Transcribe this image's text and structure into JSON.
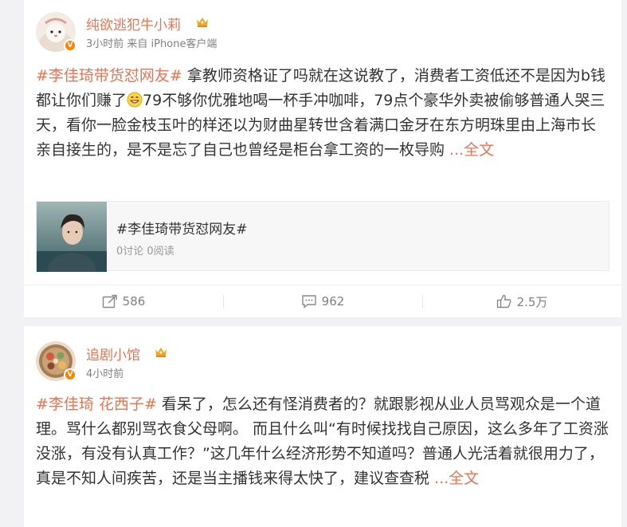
{
  "posts": [
    {
      "username": "纯欲逃犯牛小莉",
      "time": "3小时前",
      "source": "来自 iPhone客户端",
      "text_tag": "#李佳琦带货怼网友#",
      "text_body_1": " 拿教师资格证了吗就在这说教了，消费者工资低还不是因为b钱都让你们赚了",
      "text_body_2": "79不够你优雅地喝一杯手冲咖啡，79点个豪华外卖被偷够普通人哭三天，看你一脸金枝玉叶的样还以为财曲星转世含着满口金牙在东方明珠里由上海市长亲自接生的，是不是忘了自己也曾经是柜台拿工资的一枚导购 ",
      "more": "...全文",
      "topic": {
        "title": "#李佳琦带货怼网友#",
        "stats": "0讨论 0阅读"
      },
      "actions": {
        "repost": "586",
        "comment": "962",
        "like": "2.5万"
      }
    },
    {
      "username": "追剧小馆",
      "time": "4小时前",
      "text_tag": "#李佳琦 花西子#",
      "text_body_1": " 看呆了，怎么还有怪消费者的？就跟影视从业人员骂观众是一个道理。骂什么都别骂衣食父母啊。 而且什么叫“有时候找找自己原因，这么多年了工资涨没涨，有没有认真工作？”这几年什么经济形势不知道吗？普通人光活着就很用力了，真是不知人间疾苦，还是当主播钱来得太快了，建议查查税 ",
      "more": "...全文"
    }
  ],
  "icons": {
    "verified_badge": "V",
    "crown": "crown-icon",
    "emoji": "grin-emoji-icon",
    "repost": "share-icon",
    "comment": "comment-icon",
    "like": "thumbs-up-icon"
  },
  "colors": {
    "accent": "#eb7350",
    "verified": "#ff8200",
    "meta": "#808080",
    "background": "#f2f2f5"
  }
}
